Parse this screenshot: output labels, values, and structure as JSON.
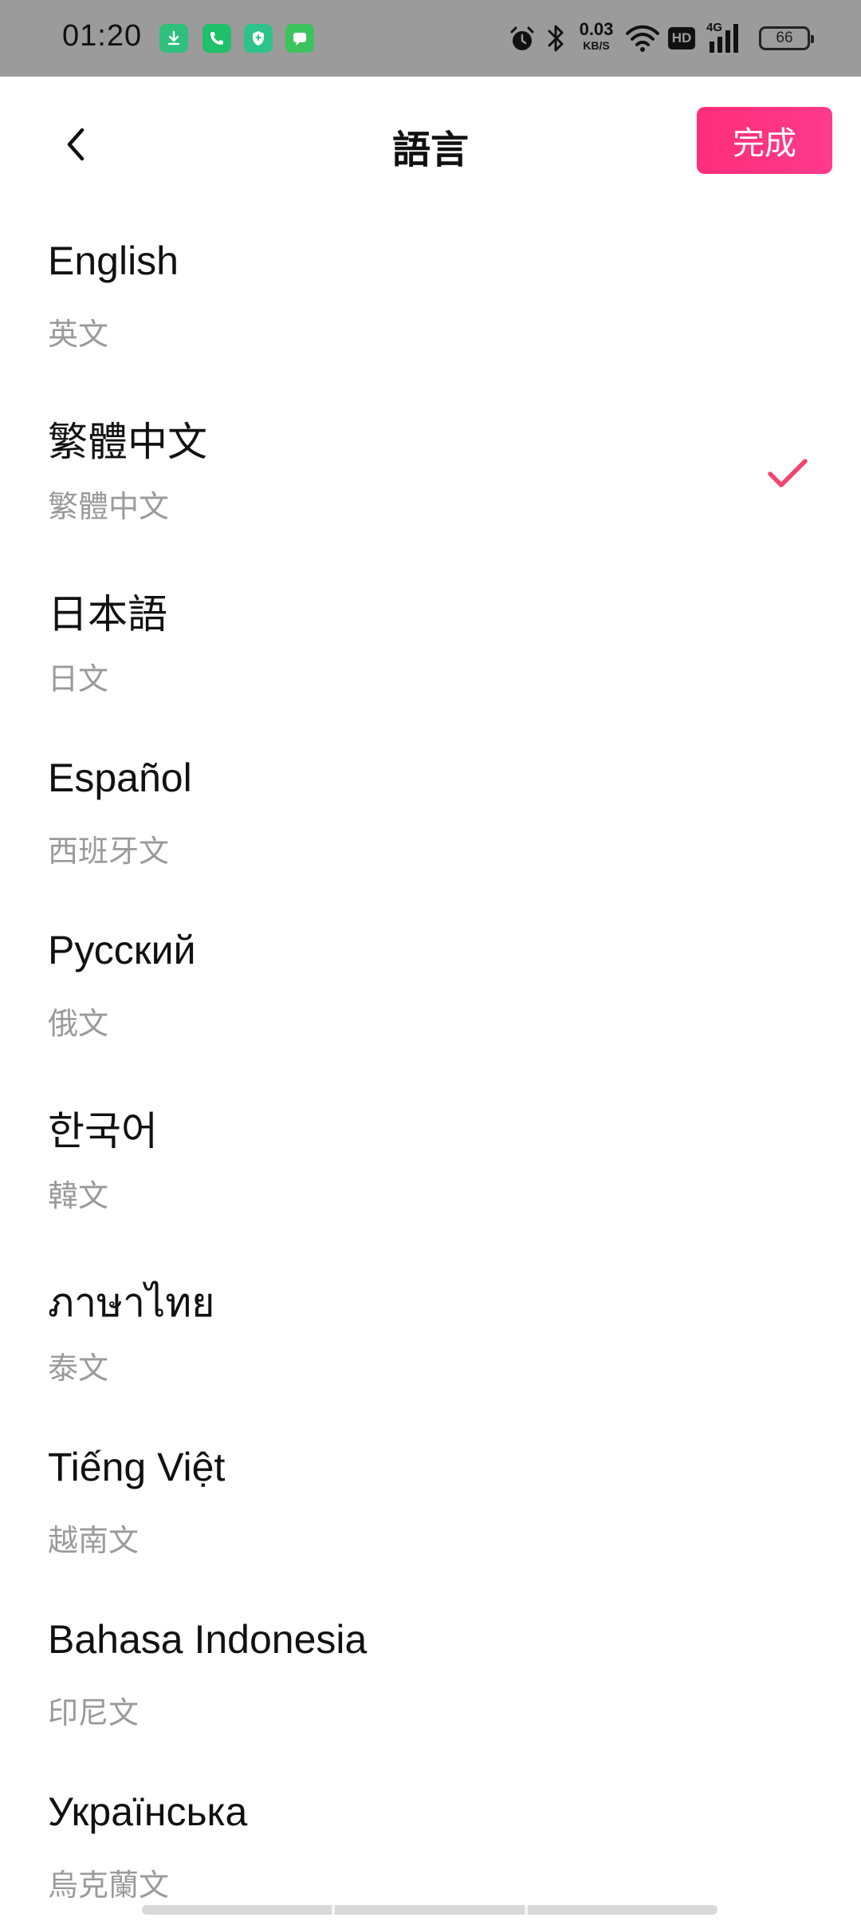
{
  "status_bar": {
    "time": "01:20",
    "net_speed_value": "0.03",
    "net_speed_unit": "KB/S",
    "hd_label": "HD",
    "cell_label": "4G",
    "battery_level": "66",
    "notification_icons": [
      "download-icon",
      "phone-icon",
      "shield-icon",
      "message-icon"
    ],
    "notification_colors": [
      "#2fc07c",
      "#1fc06a",
      "#2ec38a",
      "#3bc45d"
    ]
  },
  "header": {
    "title": "語言",
    "done_label": "完成",
    "done_color": "#ff2d79"
  },
  "languages": [
    {
      "native": "English",
      "sub": "英文",
      "selected": false
    },
    {
      "native": "繁體中文",
      "sub": "繁體中文",
      "selected": true
    },
    {
      "native": "日本語",
      "sub": "日文",
      "selected": false
    },
    {
      "native": "Español",
      "sub": "西班牙文",
      "selected": false
    },
    {
      "native": "Русский",
      "sub": "俄文",
      "selected": false
    },
    {
      "native": "한국어",
      "sub": "韓文",
      "selected": false
    },
    {
      "native": "ภาษาไทย",
      "sub": "泰文",
      "selected": false
    },
    {
      "native": "Tiếng Việt",
      "sub": "越南文",
      "selected": false
    },
    {
      "native": "Bahasa Indonesia",
      "sub": "印尼文",
      "selected": false
    },
    {
      "native": "Українська",
      "sub": "烏克蘭文",
      "selected": false
    }
  ],
  "accent_color": "#f0456e"
}
